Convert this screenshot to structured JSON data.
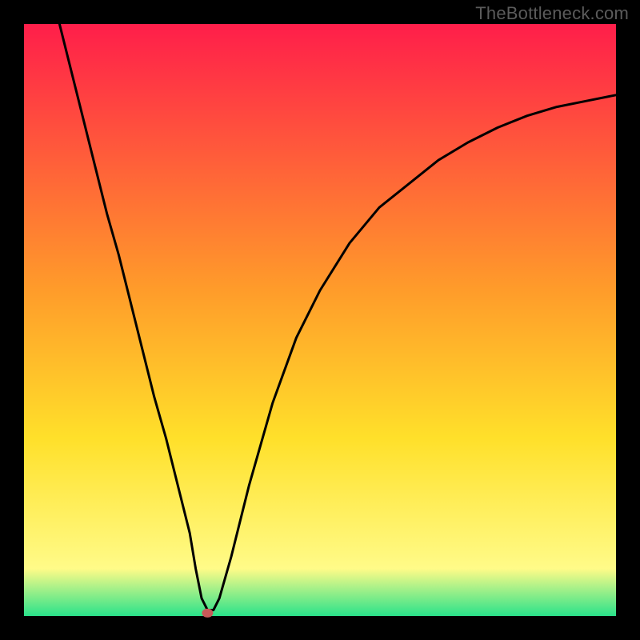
{
  "watermark": "TheBottleneck.com",
  "chart_data": {
    "type": "line",
    "title": "",
    "xlabel": "",
    "ylabel": "",
    "xlim": [
      0,
      100
    ],
    "ylim": [
      0,
      100
    ],
    "background": {
      "gradient_colors": [
        "#ff1e4a",
        "#ff9c2a",
        "#ffe02a",
        "#fffb88",
        "#2ae28a"
      ],
      "gradient_stops": [
        0,
        0.45,
        0.7,
        0.92,
        1.0
      ]
    },
    "series": [
      {
        "name": "curve",
        "x": [
          6,
          8,
          10,
          12,
          14,
          16,
          18,
          20,
          22,
          24,
          26,
          28,
          29,
          30,
          31,
          32,
          33,
          35,
          38,
          42,
          46,
          50,
          55,
          60,
          65,
          70,
          75,
          80,
          85,
          90,
          95,
          100
        ],
        "y": [
          100,
          92,
          84,
          76,
          68,
          61,
          53,
          45,
          37,
          30,
          22,
          14,
          8,
          3,
          1,
          1,
          3,
          10,
          22,
          36,
          47,
          55,
          63,
          69,
          73,
          77,
          80,
          82.5,
          84.5,
          86,
          87,
          88
        ]
      }
    ],
    "marker": {
      "x": 31,
      "y": 0.5,
      "color": "#c85a5a",
      "radius": 7
    }
  }
}
